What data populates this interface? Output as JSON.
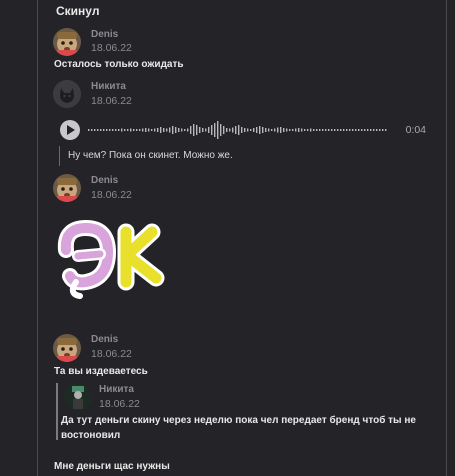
{
  "colors": {
    "background": "#242428",
    "text": "#e8e8e8",
    "muted": "#8a8a90",
    "sticker_pink": "#d9a3dc",
    "sticker_yellow": "#e8e02a"
  },
  "messages": [
    {
      "text": "Скинул"
    },
    {
      "author": "Denis",
      "date": "18.06.22",
      "text": "Осталось только ожидать"
    },
    {
      "author": "Никита",
      "date": "18.06.22",
      "voice_duration": "0:04",
      "quote": "Ну чем? Пока он скинет. Можно же."
    },
    {
      "author": "Denis",
      "date": "18.06.22",
      "sticker": "эк-sticker"
    },
    {
      "author": "Denis",
      "date": "18.06.22",
      "text": "Та вы издеваетесь",
      "reply": {
        "author": "Никита",
        "date": "18.06.22",
        "text": "Да тут деньги скину через неделю пока чел передает бренд чтоб ты не востоновил"
      }
    },
    {
      "text": "Мне деньги щас нужны"
    }
  ]
}
